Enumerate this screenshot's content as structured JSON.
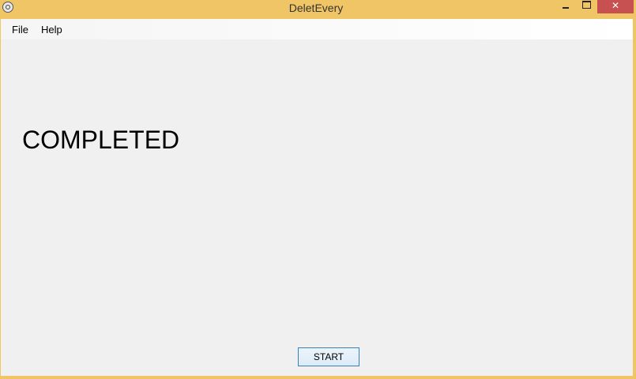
{
  "window": {
    "title": "DeletEvery",
    "frame_color": "#f0c565",
    "close_color": "#c75050"
  },
  "controls": {
    "minimize_icon": "minimize-icon",
    "maximize_icon": "maximize-icon",
    "close_label": "✕"
  },
  "menu": {
    "items": [
      {
        "label": "File"
      },
      {
        "label": "Help"
      }
    ]
  },
  "main": {
    "status_text": "COMPLETED",
    "start_label": "START"
  }
}
